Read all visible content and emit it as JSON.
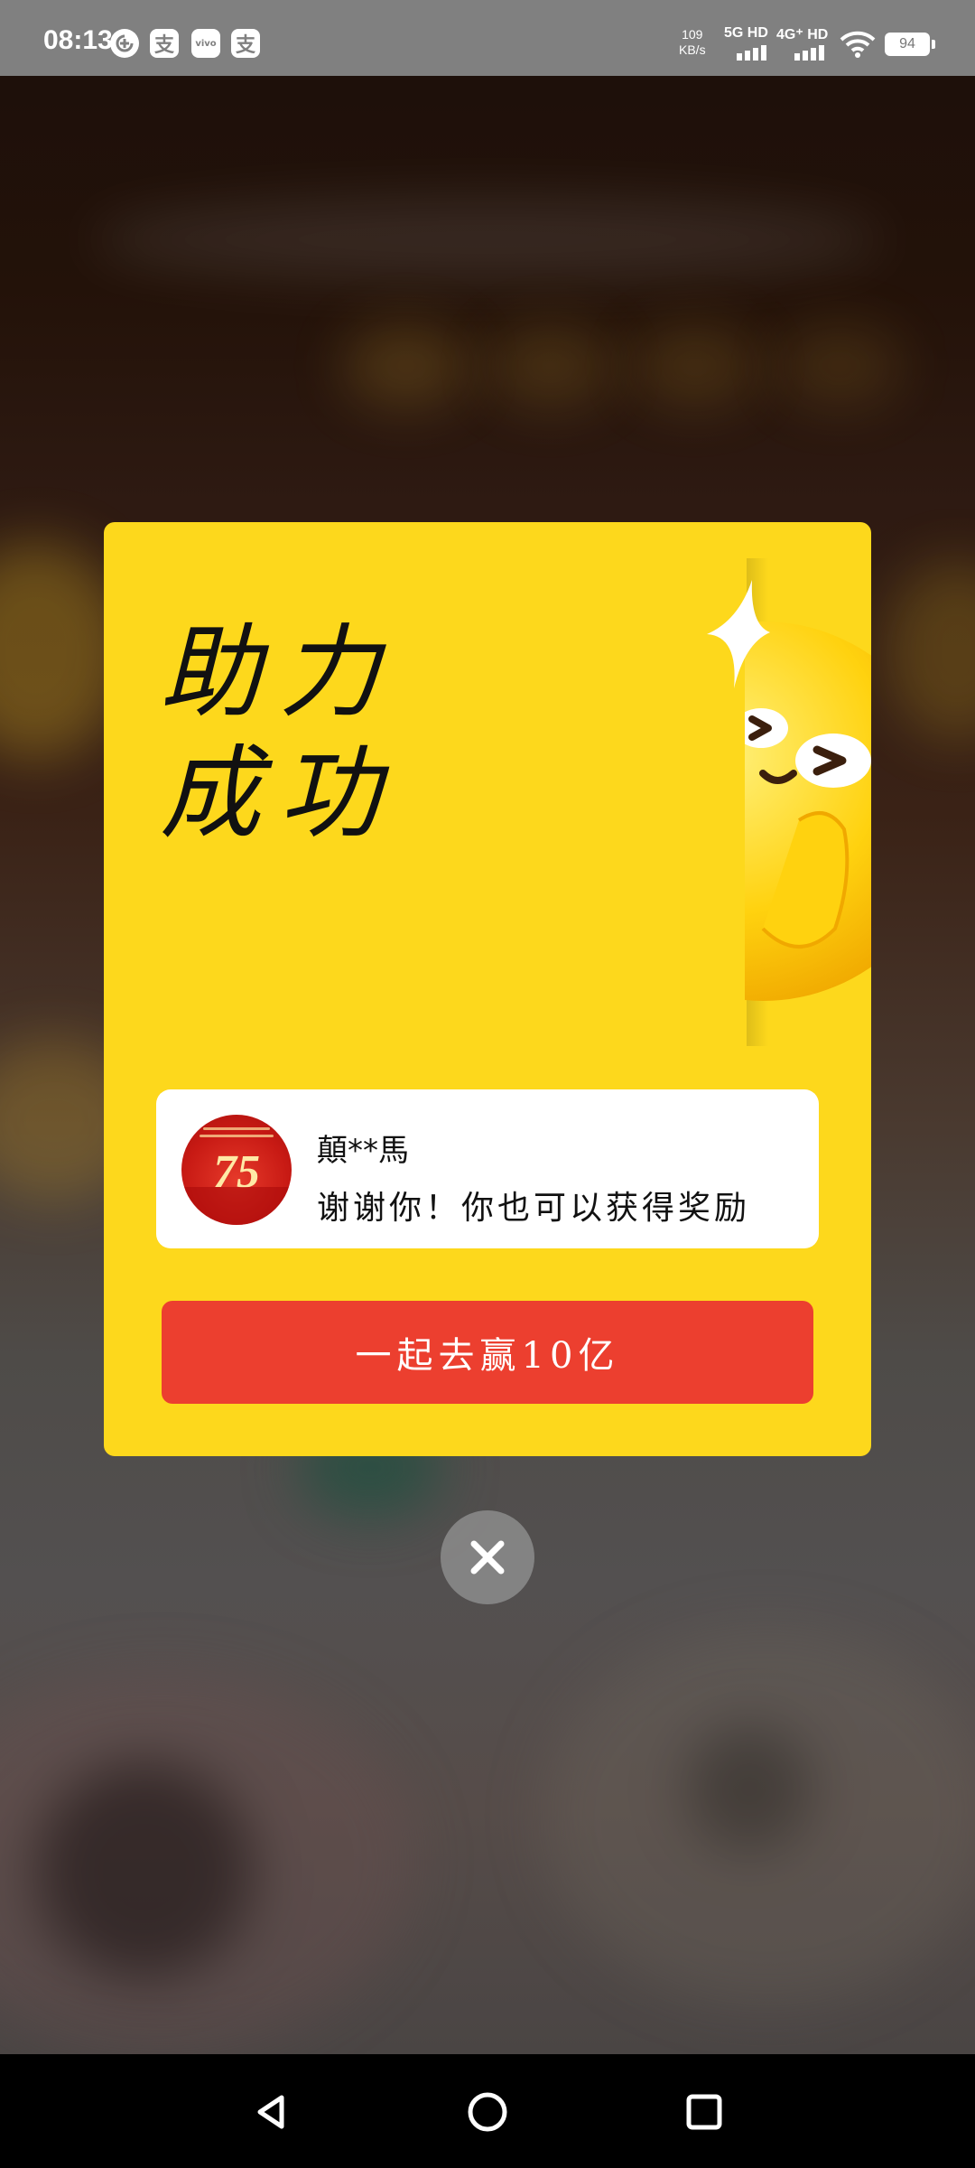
{
  "status_bar": {
    "time": "08:13",
    "app_icons": [
      "sync-icon",
      "支",
      "vivo",
      "支"
    ],
    "net_speed_value": "109",
    "net_speed_unit": "KB/s",
    "sim1_label": "5G HD",
    "sim2_label": "4G⁺ HD",
    "battery": "94"
  },
  "modal": {
    "title_line1": "助力",
    "title_line2": "成功",
    "user_name": "顛**馬",
    "user_message": "谢谢你！你也可以获得奖励",
    "cta_label": "一起去赢10亿",
    "avatar_badge": "75"
  },
  "colors": {
    "modal_bg": "#fdd81c",
    "cta_bg": "#ec3f2f",
    "status_bar_bg": "#808080"
  },
  "icons": {
    "close": "close-icon",
    "nav_back": "back-triangle-icon",
    "nav_home": "home-circle-icon",
    "nav_recents": "recents-square-icon"
  }
}
